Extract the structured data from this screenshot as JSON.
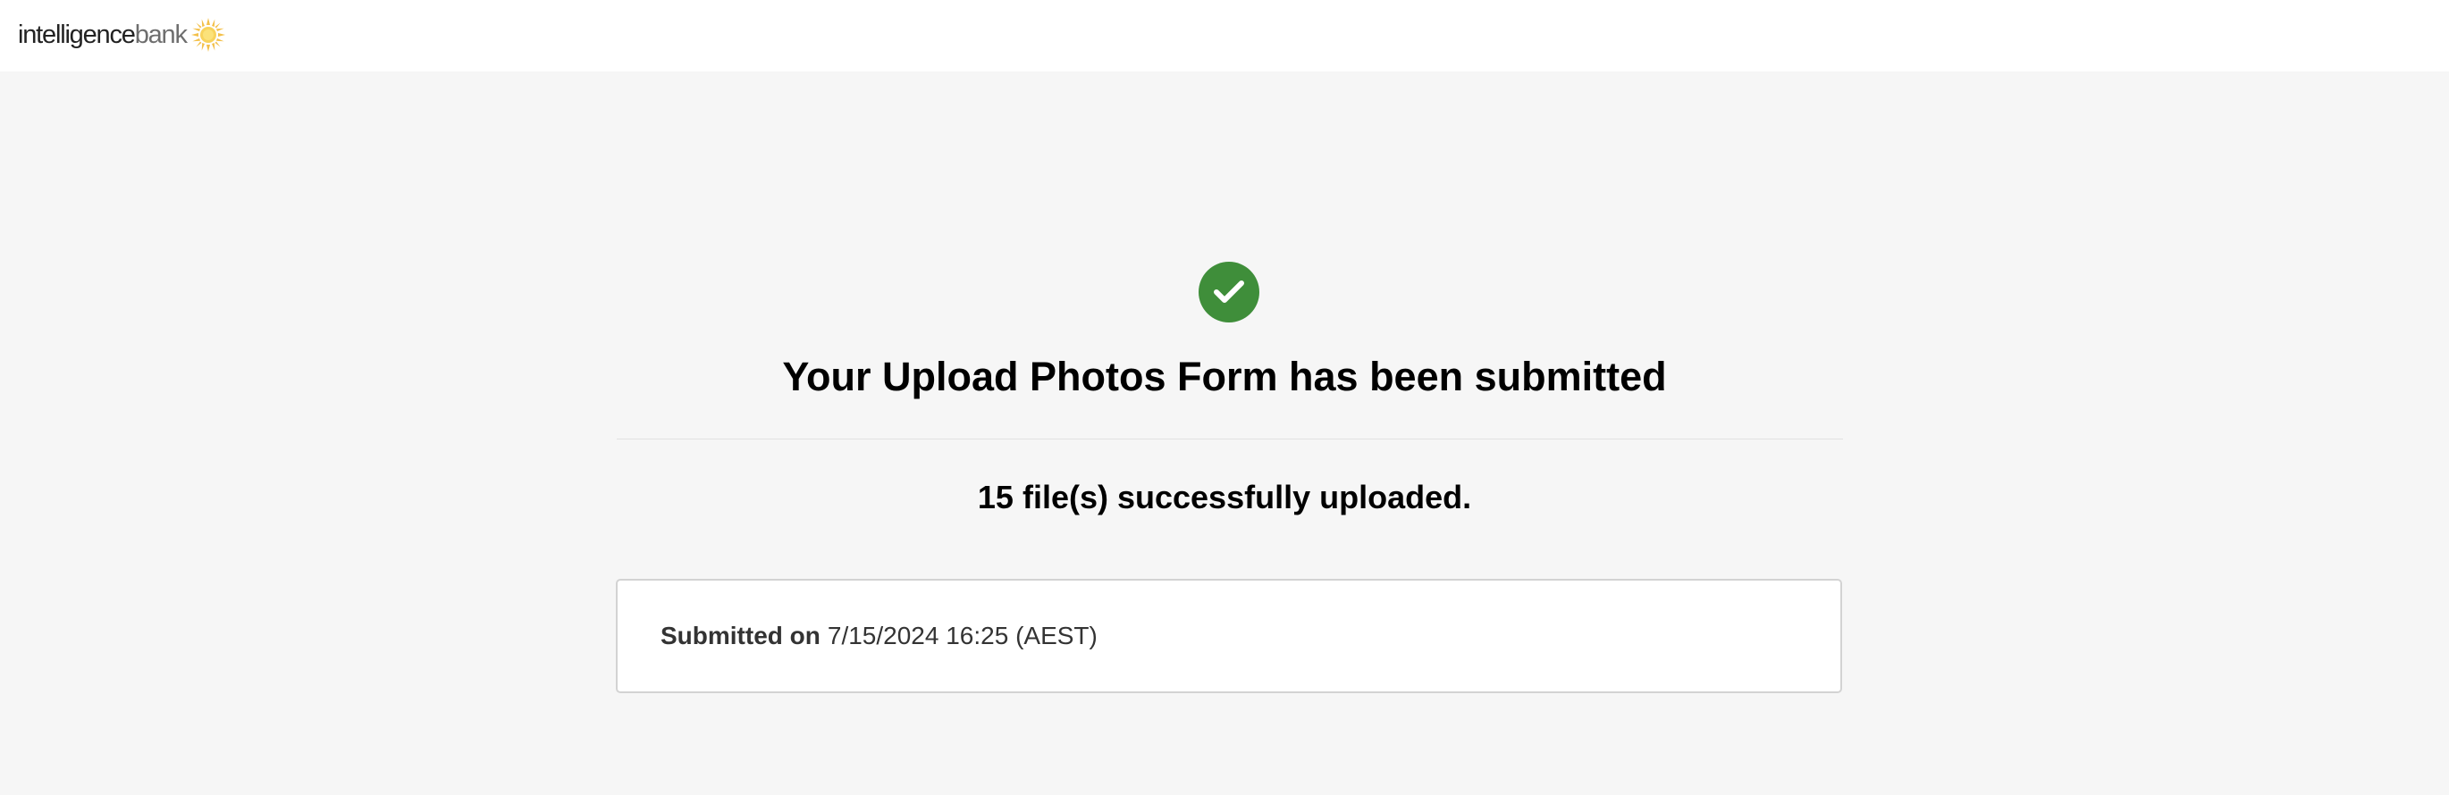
{
  "header": {
    "logo_text_dark": "intelligence",
    "logo_text_light": "bank",
    "logo_icon": "sun-icon",
    "logo_icon_color": "#f5c542"
  },
  "confirmation": {
    "icon": "check-circle-icon",
    "icon_color": "#3f8e3a",
    "title": "Your Upload Photos Form has been submitted",
    "upload_message": "15 file(s) successfully uploaded.",
    "submitted_label": "Submitted on",
    "submitted_value": "7/15/2024 16:25 (AEST)"
  }
}
